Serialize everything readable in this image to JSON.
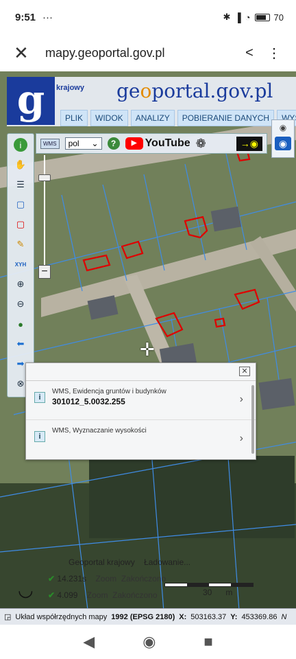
{
  "status_bar": {
    "time": "9:51",
    "extra": "···",
    "battery": "70",
    "battery_level": 0.7
  },
  "browser": {
    "url": "mapy.geoportal.gov.pl",
    "close_glyph": "✕",
    "share_glyph": "<",
    "more_glyph": "⋮"
  },
  "header": {
    "brand_g": "g",
    "subtitle": "krajowy",
    "brand_pre": "ge",
    "brand_accent": "o",
    "brand_post": "portal.gov.pl",
    "menu": [
      "PLIK",
      "WIDOK",
      "ANALIZY",
      "POBIERANIE DANYCH",
      "WYSZUKIW"
    ]
  },
  "toolbar": {
    "wms": "WMS",
    "language": "pol",
    "help": "?",
    "youtube": "YouTube"
  },
  "popup": {
    "rows": [
      {
        "title": "WMS, Ewidencja gruntów i budynków",
        "value": "301012_5.0032.255"
      },
      {
        "title": "WMS, Wyznaczanie wysokości",
        "value": ""
      }
    ]
  },
  "bottom": {
    "status_title": "Geoportal krajowy",
    "status_loading": "Ładowanie...",
    "rows": [
      {
        "time": "14.231s",
        "label": "Zoom",
        "state": "Zakończono"
      },
      {
        "time": "4.099",
        "label": "Zoom",
        "state": "Zakończono"
      }
    ],
    "scale_value": "30",
    "scale_unit": "m"
  },
  "coords": {
    "system_label": "Układ współrzędnych mapy",
    "system_value": "1992 (EPSG 2180)",
    "x_label": "X:",
    "x_value": "503163.37",
    "y_label": "Y:",
    "y_value": "453369.86",
    "more": "N"
  },
  "colors": {
    "brand_blue": "#1a3b9c",
    "parcel_line": "#3f8ce6",
    "building_outline": "#e00000"
  }
}
